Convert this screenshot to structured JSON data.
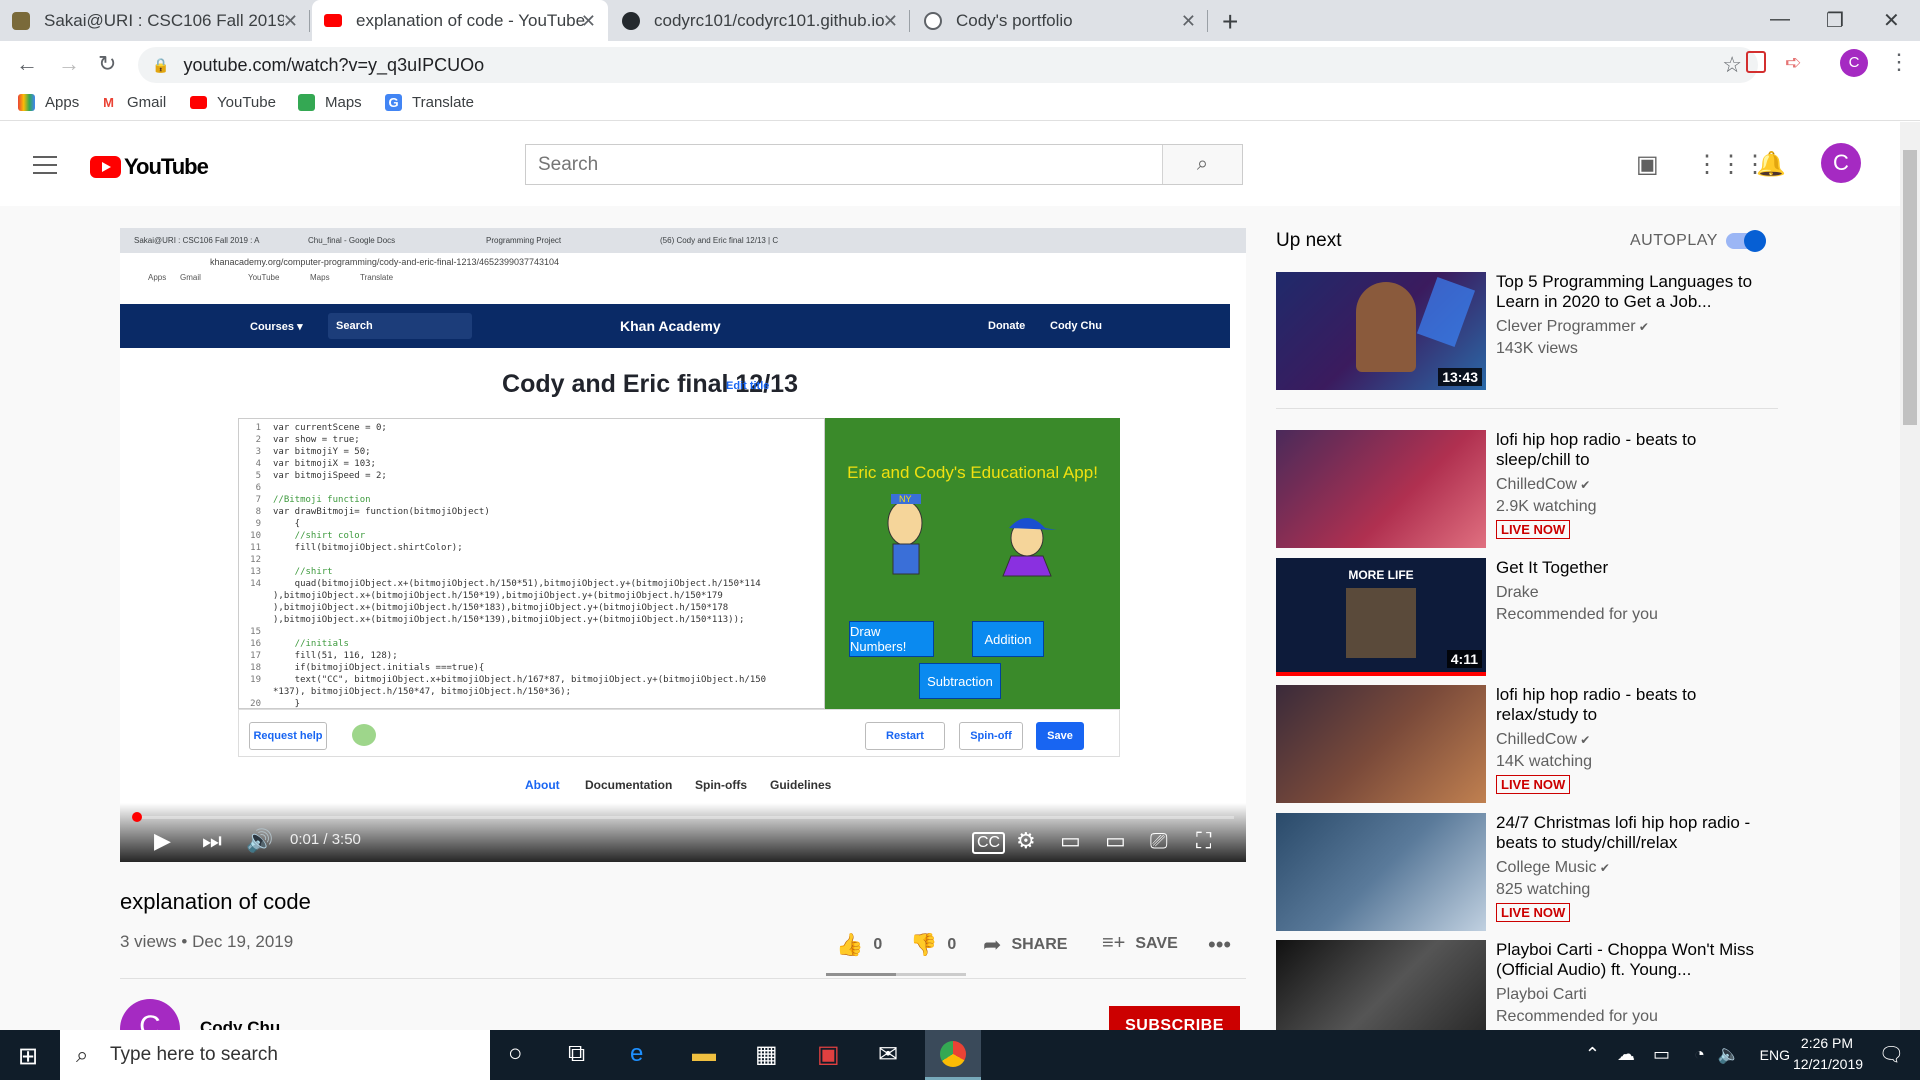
{
  "browser": {
    "tabs": [
      {
        "title": "Sakai@URI : CSC106 Fall 2019 : A",
        "active": false
      },
      {
        "title": "explanation of code - YouTube",
        "active": true
      },
      {
        "title": "codyrc101/codyrc101.github.io",
        "active": false
      },
      {
        "title": "Cody's portfolio",
        "active": false
      }
    ],
    "url": "youtube.com/watch?v=y_q3uIPCUOo",
    "bookmarks": [
      "Apps",
      "Gmail",
      "YouTube",
      "Maps",
      "Translate"
    ],
    "profile_initial": "C"
  },
  "youtube": {
    "logo_text": "YouTube",
    "search_placeholder": "Search",
    "avatar_initial": "C"
  },
  "player": {
    "time": "0:01 / 3:50",
    "progress_fraction": 0.0004,
    "inner": {
      "tabs": [
        "Sakai@URI : CSC106 Fall 2019 : A",
        "Chu_final - Google Docs",
        "Programming Project",
        "(56) Cody and Eric final 12/13 | C"
      ],
      "url": "khanacademy.org/computer-programming/cody-and-eric-final-1213/4652399037743104",
      "bookmarks": [
        "Apps",
        "Gmail",
        "YouTube",
        "Maps",
        "Translate"
      ],
      "nav": {
        "courses": "Courses ▾",
        "search": "Search",
        "brand": "Khan Academy",
        "donate": "Donate",
        "user": "Cody Chu"
      },
      "title": "Cody and Eric final 12/13",
      "edit_title": "Edit title",
      "code_lines": [
        {
          "n": "1",
          "t": "var currentScene = 0;"
        },
        {
          "n": "2",
          "t": "var show = true;"
        },
        {
          "n": "3",
          "t": "var bitmojiY = 50;"
        },
        {
          "n": "4",
          "t": "var bitmojiX = 103;"
        },
        {
          "n": "5",
          "t": "var bitmojiSpeed = 2;"
        },
        {
          "n": "6",
          "t": ""
        },
        {
          "n": "7",
          "t": "//Bitmoji function"
        },
        {
          "n": "8",
          "t": "var drawBitmoji= function(bitmojiObject)"
        },
        {
          "n": "9",
          "t": "    {"
        },
        {
          "n": "10",
          "t": "    //shirt color"
        },
        {
          "n": "11",
          "t": "    fill(bitmojiObject.shirtColor);"
        },
        {
          "n": "12",
          "t": ""
        },
        {
          "n": "13",
          "t": "    //shirt"
        },
        {
          "n": "14",
          "t": "    quad(bitmojiObject.x+(bitmojiObject.h/150*51),bitmojiObject.y+(bitmojiObject.h/150*114"
        },
        {
          "n": "",
          "t": "),bitmojiObject.x+(bitmojiObject.h/150*19),bitmojiObject.y+(bitmojiObject.h/150*179"
        },
        {
          "n": "",
          "t": "),bitmojiObject.x+(bitmojiObject.h/150*183),bitmojiObject.y+(bitmojiObject.h/150*178"
        },
        {
          "n": "",
          "t": "),bitmojiObject.x+(bitmojiObject.h/150*139),bitmojiObject.y+(bitmojiObject.h/150*113));"
        },
        {
          "n": "15",
          "t": ""
        },
        {
          "n": "16",
          "t": "    //initials"
        },
        {
          "n": "17",
          "t": "    fill(51, 116, 128);"
        },
        {
          "n": "18",
          "t": "    if(bitmojiObject.initials ===true){"
        },
        {
          "n": "19",
          "t": "    text(\"CC\", bitmojiObject.x+bitmojiObject.h/167*87, bitmojiObject.y+(bitmojiObject.h/150"
        },
        {
          "n": "",
          "t": "*137), bitmojiObject.h/150*47, bitmojiObject.h/150*36);"
        },
        {
          "n": "20",
          "t": "    }"
        },
        {
          "n": "21",
          "t": ""
        }
      ],
      "canvas": {
        "title": "Eric and Cody's Educational App!",
        "hat_text": "NY",
        "buttons": [
          "Draw Numbers!",
          "Addition",
          "Subtraction"
        ]
      },
      "footer": {
        "request_help": "Request help",
        "restart": "Restart",
        "spinoff": "Spin-off",
        "save": "Save"
      },
      "subtabs": [
        "About",
        "Documentation",
        "Spin-offs",
        "Guidelines"
      ],
      "taskbar_search": "Type here to search"
    }
  },
  "video": {
    "title": "explanation of code",
    "info": "3 views • Dec 19, 2019",
    "likes": "0",
    "dislikes": "0",
    "share": "SHARE",
    "save": "SAVE",
    "channel": "Cody Chu",
    "channel_initial": "C",
    "subscribe": "SUBSCRIBE"
  },
  "sidebar": {
    "up_next": "Up next",
    "autoplay": "AUTOPLAY",
    "autoplay_on": true,
    "videos": [
      {
        "title": "Top 5 Programming Languages to Learn in 2020 to Get a Job...",
        "channel": "Clever Programmer",
        "verified": true,
        "meta": "143K views",
        "duration": "13:43",
        "live": ""
      },
      {
        "title": "lofi hip hop radio - beats to sleep/chill to",
        "channel": "ChilledCow",
        "verified": true,
        "meta": "2.9K watching",
        "duration": "",
        "live": "LIVE NOW"
      },
      {
        "title": "Get It Together",
        "channel": "Drake",
        "verified": false,
        "meta": "Recommended for you",
        "duration": "4:11",
        "live": "",
        "thumb_text": "MORE LIFE"
      },
      {
        "title": "lofi hip hop radio - beats to relax/study to",
        "channel": "ChilledCow",
        "verified": true,
        "meta": "14K watching",
        "duration": "",
        "live": "LIVE NOW"
      },
      {
        "title": "24/7 Christmas lofi hip hop radio - beats to study/chill/relax",
        "channel": "College Music",
        "verified": true,
        "meta": "825 watching",
        "duration": "",
        "live": "LIVE NOW"
      },
      {
        "title": "Playboi Carti - Choppa Won't Miss (Official Audio) ft. Young...",
        "channel": "Playboi Carti",
        "verified": false,
        "meta": "Recommended for you",
        "duration": "",
        "live": ""
      }
    ]
  },
  "taskbar": {
    "search_placeholder": "Type here to search",
    "lang": "ENG",
    "time": "2:26 PM",
    "date": "12/21/2019"
  },
  "colors": {
    "youtube_red": "#ff0000",
    "avatar": "#a52ac2",
    "toggle": "#065fd4",
    "khan_nav": "#0a2a66",
    "canvas_green": "#3a8a2a"
  }
}
